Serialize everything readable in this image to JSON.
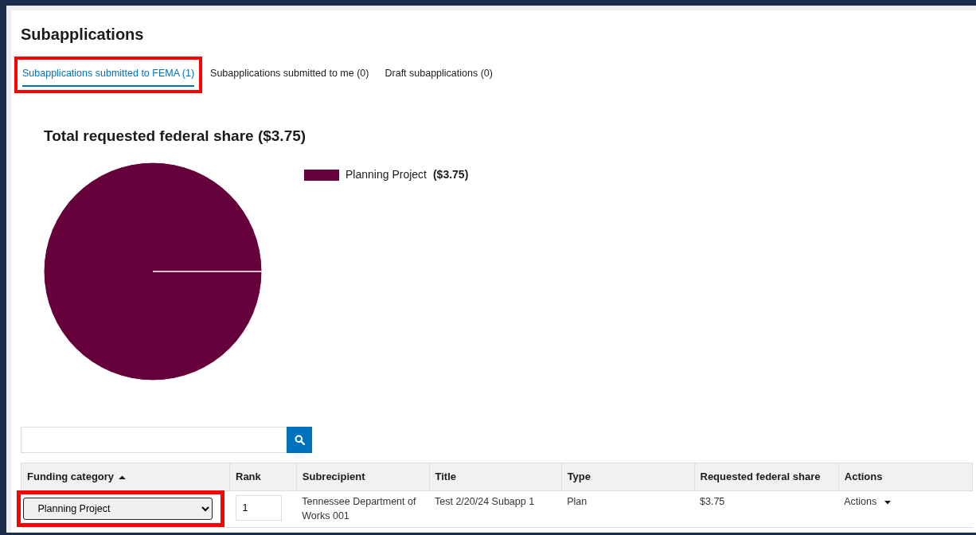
{
  "page": {
    "title": "Subapplications"
  },
  "tabs": [
    {
      "label": "Subapplications submitted to FEMA (1)",
      "selected": true,
      "highlighted": true
    },
    {
      "label": "Subapplications submitted to me (0)",
      "selected": false,
      "highlighted": false
    },
    {
      "label": "Draft subapplications (0)",
      "selected": false,
      "highlighted": false
    }
  ],
  "chart": {
    "legend": [
      {
        "value": "($3.75)",
        "color": "#66003a"
      }
    ],
    "chart_data": {
      "type": "pie",
      "title": "Total requested federal share ($3.75)",
      "categories": [
        "Planning Project"
      ],
      "values": [
        100
      ]
    }
  },
  "table": {
    "columns": [
      {
        "label": "Funding category",
        "sorted": true
      },
      {
        "label": "Rank",
        "sorted": false
      },
      {
        "label": "Subrecipient",
        "sorted": false
      },
      {
        "label": "Title",
        "sorted": false
      },
      {
        "label": "Type",
        "sorted": false
      },
      {
        "label": "Requested federal share",
        "sorted": false
      },
      {
        "label": "Actions",
        "sorted": false
      }
    ],
    "rows": [
      {
        "funding_category": "Planning Project",
        "funding_category_highlighted": true,
        "rank": "1",
        "subrecipient": "Tennessee Department of Works 001",
        "title": "Test 2/20/24 Subapp 1",
        "type": "Plan",
        "requested_federal_share": "$3.75",
        "actions": "Actions"
      }
    ]
  }
}
